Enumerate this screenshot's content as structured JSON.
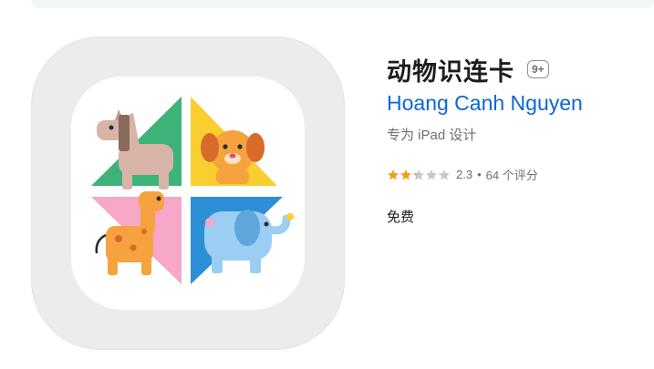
{
  "app": {
    "title": "动物识连卡",
    "age_rating": "9+",
    "developer": "Hoang Canh Nguyen",
    "subtitle": "专为 iPad 设计",
    "rating_value": "2.3",
    "rating_separator": "•",
    "rating_count": "64 个评分",
    "stars": 2.3,
    "price": "免费"
  },
  "icons": [
    "horse-icon",
    "dog-icon",
    "giraffe-icon",
    "elephant-icon",
    "star-icon"
  ],
  "colors": {
    "star_fill": "#f0a020",
    "star_empty": "#c7c7cc",
    "developer_link": "#0b66d6",
    "tile_green": "#3db37a",
    "tile_yellow": "#f9cf2f",
    "tile_pink": "#f7a7c8",
    "tile_blue": "#2d8fd5"
  }
}
